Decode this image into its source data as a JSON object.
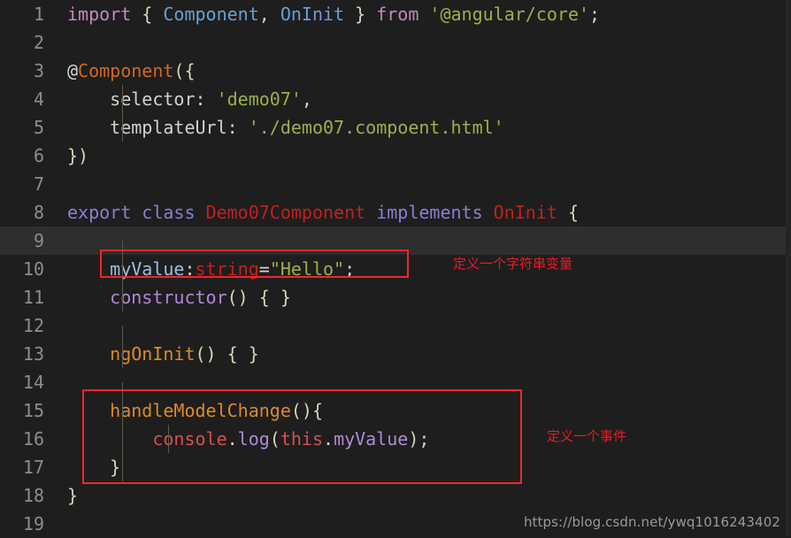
{
  "editor": {
    "background_color": "#1e1e1e",
    "current_line_color": "#2e2e2e",
    "current_line_number": 9,
    "total_lines_visible": 19,
    "language": "TypeScript",
    "font_size_px": 20,
    "line_height_px": 32
  },
  "lines": [
    {
      "number": "1",
      "text": "import { Component, OnInit } from '@angular/core';"
    },
    {
      "number": "2",
      "text": ""
    },
    {
      "number": "3",
      "text": "@Component({"
    },
    {
      "number": "4",
      "text": "    selector: 'demo07',"
    },
    {
      "number": "5",
      "text": "    templateUrl: './demo07.compoent.html'"
    },
    {
      "number": "6",
      "text": "})"
    },
    {
      "number": "7",
      "text": ""
    },
    {
      "number": "8",
      "text": "export class Demo07Component implements OnInit {"
    },
    {
      "number": "9",
      "text": ""
    },
    {
      "number": "10",
      "text": "    myValue:string=\"Hello\";"
    },
    {
      "number": "11",
      "text": "    constructor() { }"
    },
    {
      "number": "12",
      "text": ""
    },
    {
      "number": "13",
      "text": "    ngOnInit() { }"
    },
    {
      "number": "14",
      "text": ""
    },
    {
      "number": "15",
      "text": "    handleModelChange(){"
    },
    {
      "number": "16",
      "text": "        console.log(this.myValue);"
    },
    {
      "number": "17",
      "text": "    }"
    },
    {
      "number": "18",
      "text": "}"
    },
    {
      "number": "19",
      "text": ""
    }
  ],
  "line_numbers": {
    "n1": "1",
    "n2": "2",
    "n3": "3",
    "n4": "4",
    "n5": "5",
    "n6": "6",
    "n7": "7",
    "n8": "8",
    "n9": "9",
    "n10": "10",
    "n11": "11",
    "n12": "12",
    "n13": "13",
    "n14": "14",
    "n15": "15",
    "n16": "16",
    "n17": "17",
    "n18": "18",
    "n19": "19"
  },
  "tokens": {
    "l1_import": "import",
    "l1_brace_open": " { ",
    "l1_component": "Component",
    "l1_comma": ", ",
    "l1_oninit": "OnInit",
    "l1_brace_close": " } ",
    "l1_from": "from",
    "l1_module": " '@angular/core'",
    "l1_semi": ";",
    "l3_at": "@",
    "l3_decorator": "Component",
    "l3_paren": "({",
    "l4_key": "selector",
    "l4_colon": ": ",
    "l4_value": "'demo07'",
    "l4_comma": ",",
    "l5_key": "templateUrl",
    "l5_colon": ": ",
    "l5_value": "'./demo07.compoent.html'",
    "l6_close": "})",
    "l8_export": "export class",
    "l8_class": " Demo07Component ",
    "l8_implements": "implements",
    "l8_interface": " OnInit",
    "l8_brace": " {",
    "l10_name": "myValue",
    "l10_colon": ":",
    "l10_type": "string",
    "l10_equals": "=",
    "l10_value": "\"Hello\"",
    "l10_semi": ";",
    "l11_constructor": "constructor",
    "l11_parens": "() { }",
    "l13_method": "ngOnInit",
    "l13_parens": "() { }",
    "l15_method": "handleModelChange",
    "l15_parens": "(){",
    "l16_console": "console",
    "l16_dot1": ".",
    "l16_log": "log",
    "l16_paren_open": "(",
    "l16_this": "this",
    "l16_dot2": ".",
    "l16_prop": "myValue",
    "l16_paren_close": ")",
    "l16_semi": ";",
    "l17_close": "}",
    "l18_close": "}"
  },
  "annotations": [
    {
      "id": "variable",
      "label": "定义一个字符串变量",
      "color": "#e81c22",
      "target_line": 10
    },
    {
      "id": "event",
      "label": "定义一个事件",
      "color": "#e81c22",
      "target_lines": "15-17"
    }
  ],
  "annotation_labels": {
    "variable": "定义一个字符串变量",
    "event": "定义一个事件"
  },
  "watermark": {
    "text": "https://blog.csdn.net/ywq1016243402"
  },
  "colors": {
    "annotation_red": "#f0262b",
    "string_green": "#99b14b",
    "keyword_purple": "#c586c0",
    "type_blue": "#6a9fd4",
    "error_red": "#c3201f",
    "decorator_orange": "#d2691e",
    "method_orange": "#dd8a2b"
  }
}
